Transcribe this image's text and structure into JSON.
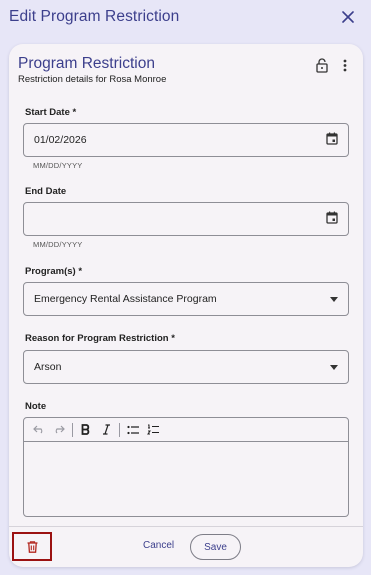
{
  "dialog": {
    "title": "Edit Program Restriction",
    "close_icon": "close-icon"
  },
  "card": {
    "title": "Program Restriction",
    "subtitle": "Restriction details for Rosa Monroe",
    "lock_icon": "lock-open-icon",
    "more_icon": "more-vertical-icon"
  },
  "fields": {
    "start_date": {
      "label": "Start Date *",
      "value": "01/02/2026",
      "helper": "MM/DD/YYYY",
      "icon": "calendar-icon"
    },
    "end_date": {
      "label": "End Date",
      "value": "",
      "helper": "MM/DD/YYYY",
      "icon": "calendar-icon"
    },
    "programs": {
      "label": "Program(s) *",
      "value": "Emergency Rental Assistance Program",
      "icon": "dropdown-arrow-icon"
    },
    "reason": {
      "label": "Reason for Program Restriction *",
      "value": "Arson",
      "icon": "dropdown-arrow-icon"
    },
    "note": {
      "label": "Note",
      "value": ""
    }
  },
  "editor_toolbar": [
    "undo-icon",
    "redo-icon",
    "bold-icon",
    "italic-icon",
    "bullet-list-icon",
    "numbered-list-icon"
  ],
  "footer": {
    "delete_icon": "trash-icon",
    "cancel_label": "Cancel",
    "save_label": "Save"
  },
  "colors": {
    "page_background": "#e7e6f7",
    "card_background": "#f6f3f7",
    "accent": "#3c3f8c",
    "delete_highlight": "#9b1111"
  }
}
